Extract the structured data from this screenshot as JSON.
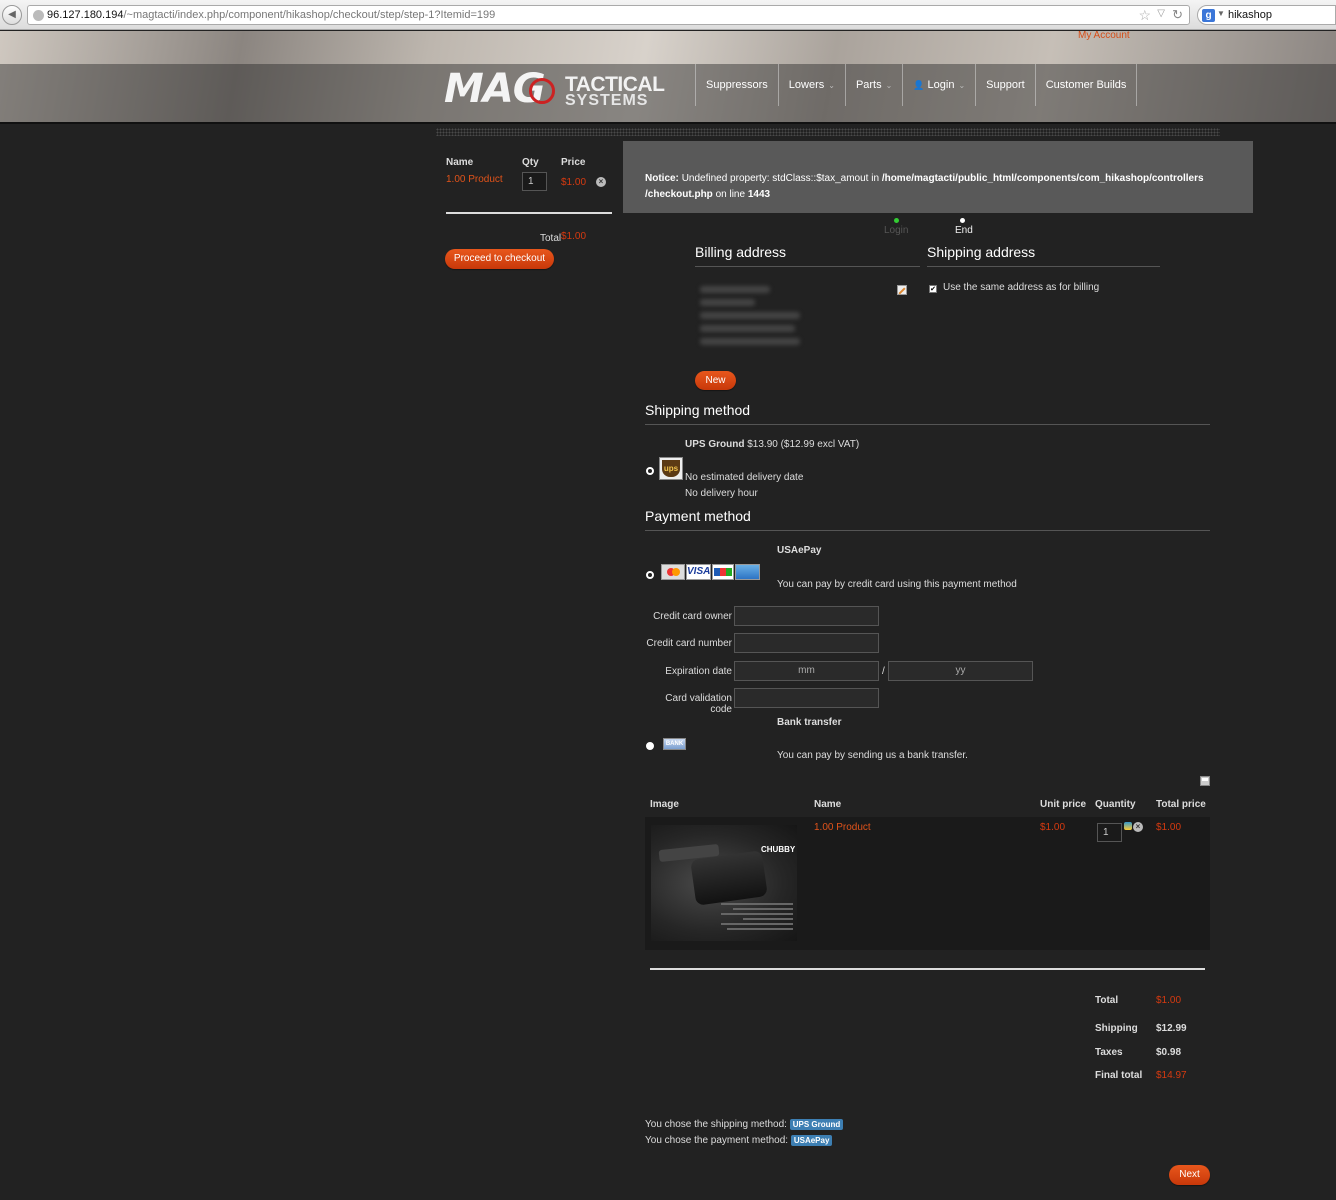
{
  "browser": {
    "url_host": "96.127.180.194",
    "url_path": "/~magtacti/index.php/component/hikashop/checkout/step/step-1?Itemid=199",
    "search_text": "hikashop"
  },
  "header": {
    "my_account": "My Account",
    "logo_mag": "MAG",
    "logo_tactical": "TACTICAL",
    "logo_systems": "SYSTEMS",
    "nav": [
      {
        "label": "Suppressors",
        "caret": false
      },
      {
        "label": "Lowers",
        "caret": true
      },
      {
        "label": "Parts",
        "caret": true
      },
      {
        "label": "Login",
        "caret": true
      },
      {
        "label": "Support",
        "caret": false
      },
      {
        "label": "Customer Builds",
        "caret": false
      }
    ]
  },
  "mini_cart": {
    "col_name": "Name",
    "col_qty": "Qty",
    "col_price": "Price",
    "item_name": "1.00 Product",
    "item_qty": "1",
    "item_price": "$1.00",
    "total_label": "Total",
    "total_value": "$1.00",
    "checkout_button": "Proceed to checkout"
  },
  "notice": {
    "prefix": "Notice:",
    "message": "Undefined property: stdClass::$tax_amout in",
    "path": "/home/magtacti/public_html/components/com_hikashop/controllers",
    "path2": "/checkout.php",
    "suffix": "on line",
    "line": "1443"
  },
  "steps": {
    "login": "Login",
    "end": "End"
  },
  "addresses": {
    "billing_title": "Billing address",
    "shipping_title": "Shipping address",
    "same_as_billing": "Use the same address as for billing",
    "new_button": "New"
  },
  "shipping": {
    "title": "Shipping method",
    "name": "UPS Ground",
    "price": "$13.90 ($12.99 excl VAT)",
    "delivery_date": "No estimated delivery date",
    "delivery_hour": "No delivery hour",
    "logo_text": "ups"
  },
  "payment": {
    "title": "Payment method",
    "usaepay_name": "USAePay",
    "usaepay_desc": "You can pay by credit card using this payment method",
    "card_visa": "VISA",
    "field_owner": "Credit card owner",
    "field_number": "Credit card number",
    "field_expiry": "Expiration date",
    "expiry_month_placeholder": "mm",
    "expiry_year_placeholder": "yy",
    "expiry_separator": "/",
    "field_cvv": "Card validation code",
    "bank_name": "Bank transfer",
    "bank_desc": "You can pay by sending us a bank transfer.",
    "bank_logo": "BANK"
  },
  "cart_table": {
    "headers": [
      "Image",
      "Name",
      "Unit price",
      "Quantity",
      "Total price"
    ],
    "row": {
      "name": "1.00 Product",
      "unit_price": "$1.00",
      "quantity": "1",
      "total_price": "$1.00",
      "image_label": "CHUBBY"
    }
  },
  "totals": {
    "total_label": "Total",
    "total_value": "$1.00",
    "shipping_label": "Shipping",
    "shipping_value": "$12.99",
    "taxes_label": "Taxes",
    "taxes_value": "$0.98",
    "final_label": "Final total",
    "final_value": "$14.97"
  },
  "summary": {
    "shipping_text": "You chose the shipping method:",
    "shipping_badge": "UPS Ground",
    "payment_text": "You chose the payment method:",
    "payment_badge": "USAePay"
  },
  "next_button": "Next",
  "colors": {
    "accent": "#d63a10",
    "notice_bg": "#595959",
    "page_bg": "#222222"
  }
}
